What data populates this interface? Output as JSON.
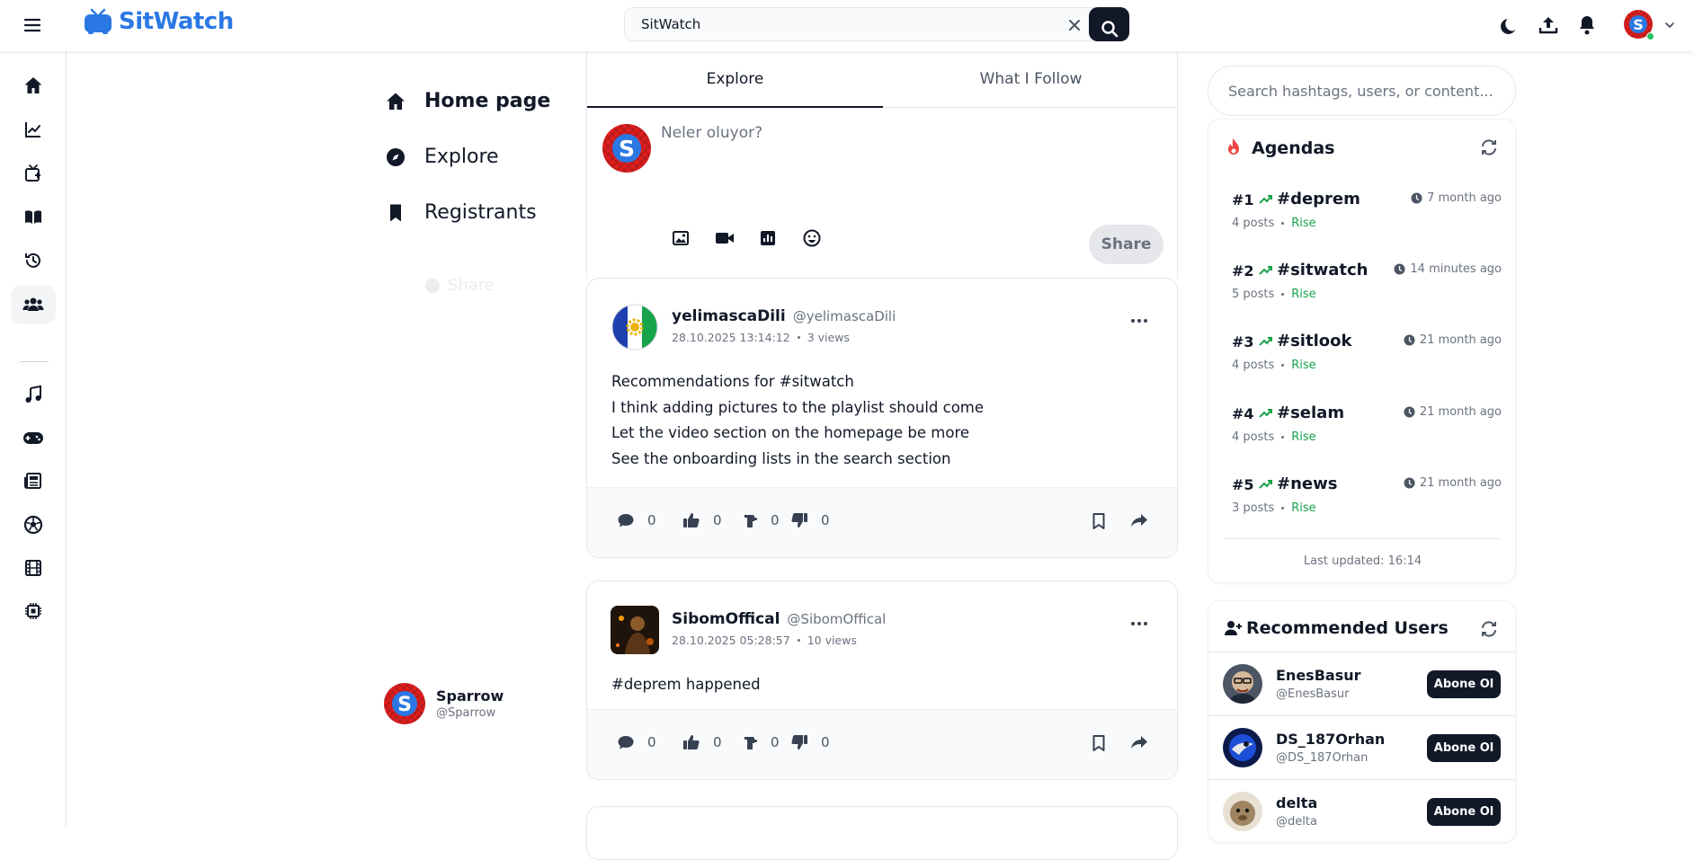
{
  "app": {
    "name": "SitWatch",
    "brand_color": "#2b78e4",
    "dark_color": "#111827",
    "accent_green": "#16a34a"
  },
  "search": {
    "value": "SitWatch",
    "placeholder": "Search"
  },
  "topbar_icons": [
    "moon-icon",
    "upload-icon",
    "bell-icon"
  ],
  "rail": {
    "items": [
      "home-icon",
      "trending-icon",
      "tv-icon",
      "book-icon",
      "history-icon",
      "users-icon",
      "music-icon",
      "gamepad-icon",
      "news-icon",
      "soccer-icon",
      "film-icon",
      "chip-icon"
    ],
    "active": "users-icon"
  },
  "nav": {
    "home": "Home page",
    "explore": "Explore",
    "registrants": "Registrants",
    "share_ghost": "Share"
  },
  "me": {
    "name": "Sparrow",
    "handle": "@Sparrow"
  },
  "feed": {
    "tabs": [
      "Explore",
      "What I Follow"
    ],
    "active_tab": "Explore",
    "composer_placeholder": "Neler oluyor?",
    "composer_tools": [
      "image-icon",
      "video-icon",
      "chart-icon",
      "emoji-icon"
    ],
    "share_label": "Share",
    "posts": [
      {
        "name": "yelimascaDili",
        "handle": "@yelimascaDili",
        "date": "28.10.2025 13:14:12",
        "views": "3 views",
        "lines": [
          "Recommendations for #sitwatch",
          "I think adding pictures to the playlist should come",
          "Let the video section on the homepage be more",
          "See the onboarding lists in the search section"
        ],
        "comments": "0",
        "likes": "0",
        "neutral": "0",
        "dislikes": "0"
      },
      {
        "name": "SibomOffical",
        "handle": "@SibomOffical",
        "date": "28.10.2025 05:28:57",
        "views": "10 views",
        "lines": [
          "#deprem happened"
        ],
        "comments": "0",
        "likes": "0",
        "neutral": "0",
        "dislikes": "0"
      }
    ]
  },
  "right": {
    "search_placeholder": "Search hashtags, users, or content...",
    "agendas": {
      "title": "Agendas",
      "items": [
        {
          "rank": "#1",
          "tag": "#deprem",
          "time": "7 month ago",
          "posts": "4 posts",
          "trend": "Rise"
        },
        {
          "rank": "#2",
          "tag": "#sitwatch",
          "time": "14 minutes ago",
          "posts": "5 posts",
          "trend": "Rise"
        },
        {
          "rank": "#3",
          "tag": "#sitlook",
          "time": "21 month ago",
          "posts": "4 posts",
          "trend": "Rise"
        },
        {
          "rank": "#4",
          "tag": "#selam",
          "time": "21 month ago",
          "posts": "4 posts",
          "trend": "Rise"
        },
        {
          "rank": "#5",
          "tag": "#news",
          "time": "21 month ago",
          "posts": "3 posts",
          "trend": "Rise"
        }
      ],
      "last_updated": "Last updated: 16:14"
    },
    "recommended": {
      "title": "Recommended Users",
      "follow_label": "Abone Ol",
      "users": [
        {
          "name": "EnesBasur",
          "handle": "@EnesBasur"
        },
        {
          "name": "DS_187Orhan",
          "handle": "@DS_187Orhan"
        },
        {
          "name": "delta",
          "handle": "@delta"
        }
      ]
    }
  }
}
